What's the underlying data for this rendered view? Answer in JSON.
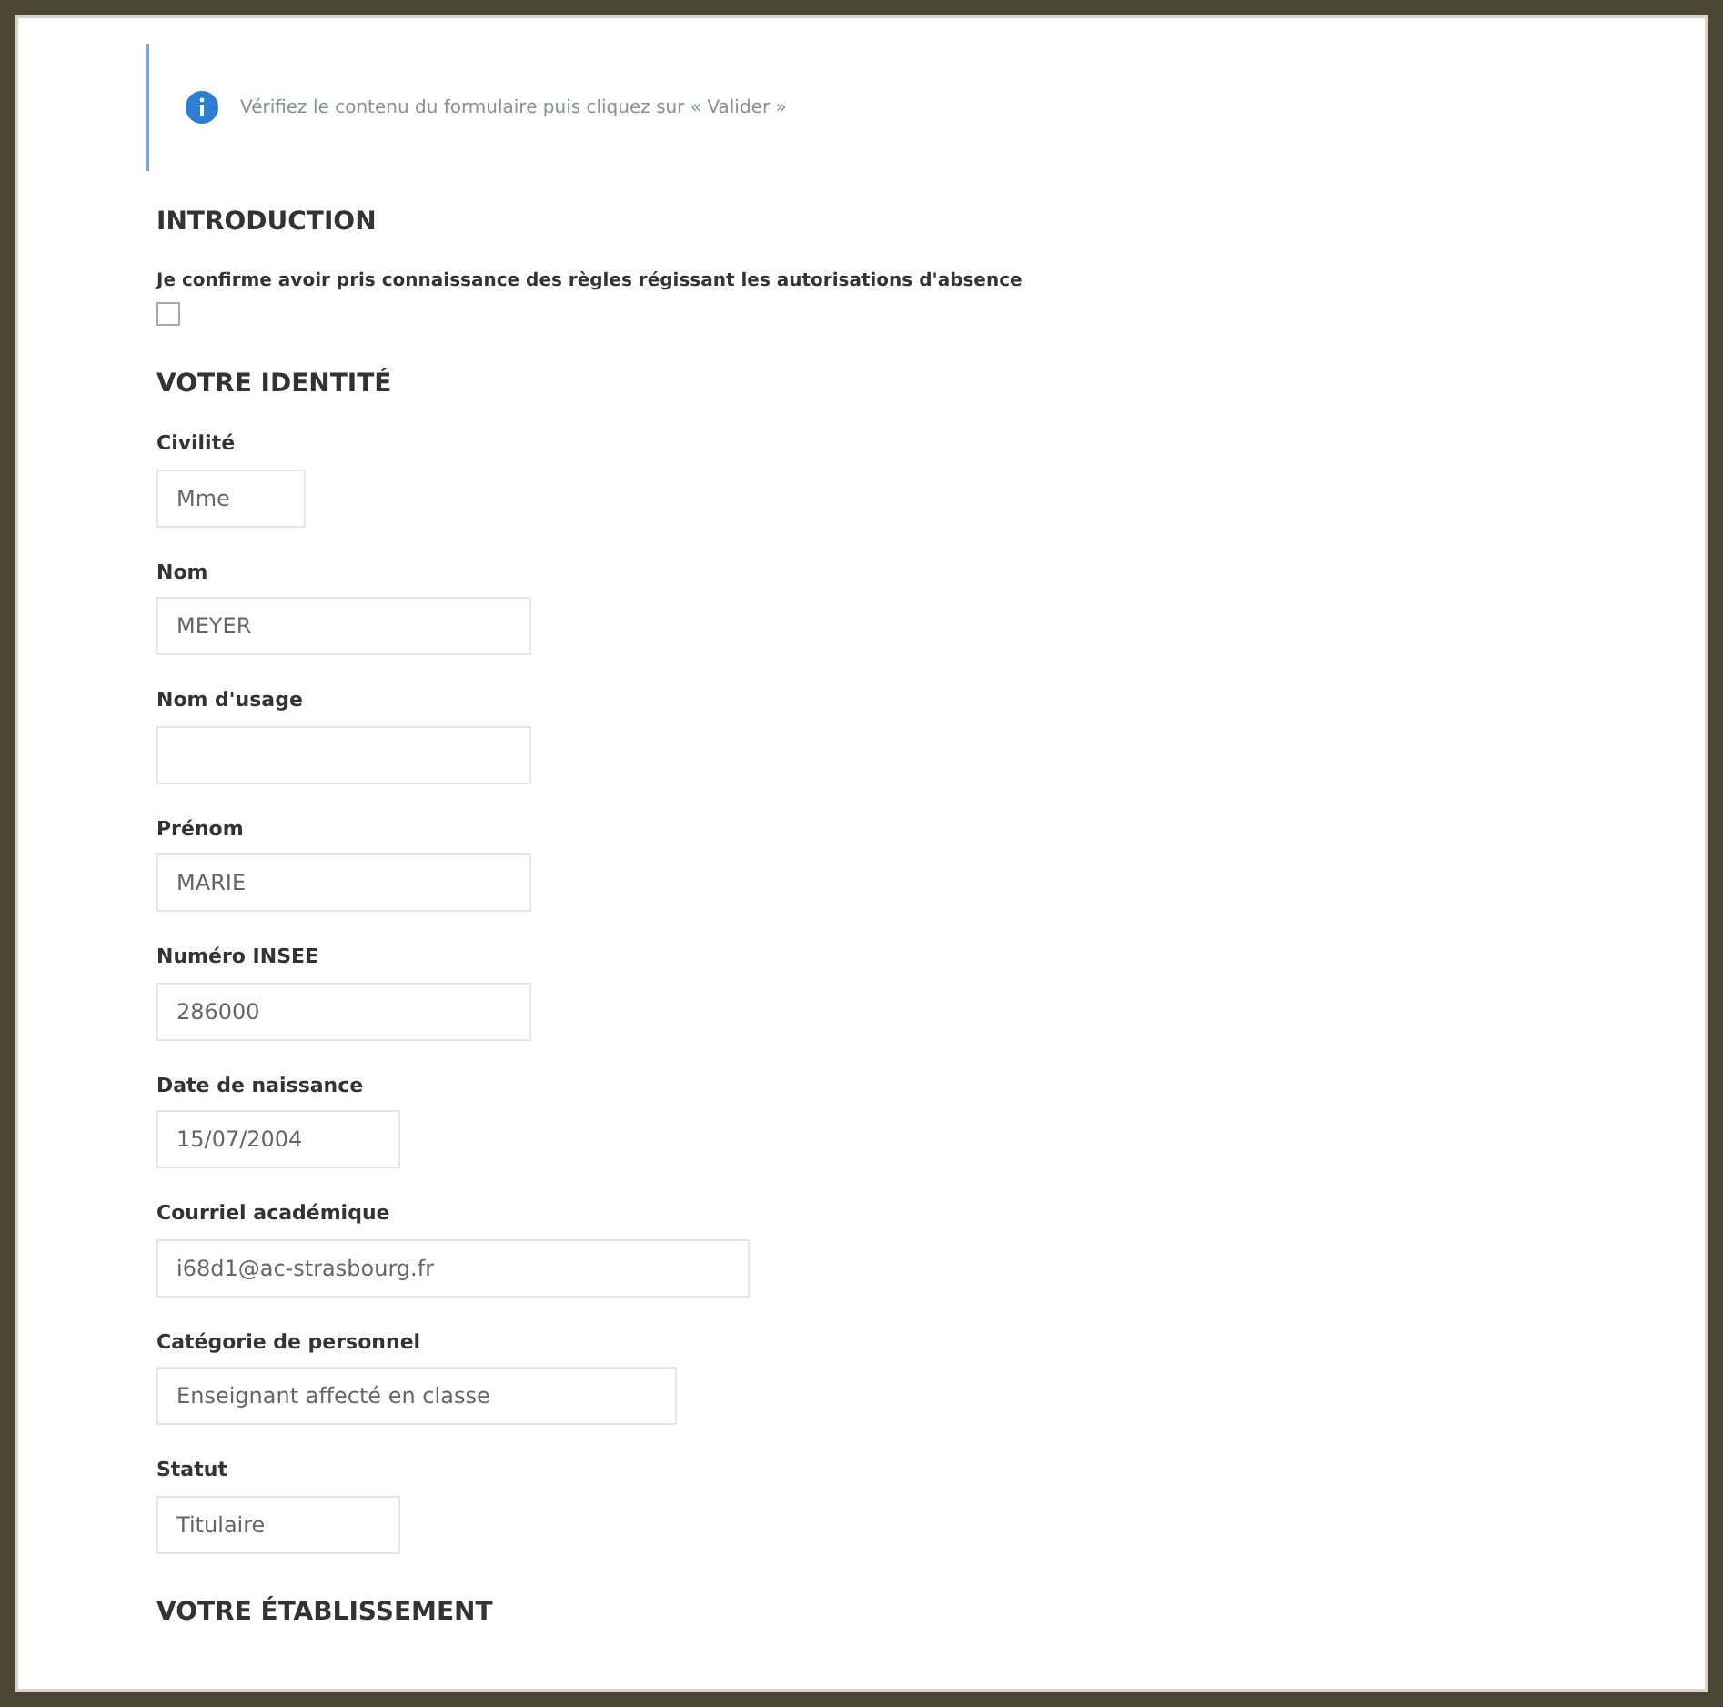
{
  "notice": {
    "text": "Vérifiez le contenu du formulaire puis cliquez sur « Valider »"
  },
  "sections": [
    {
      "title": "INTRODUCTION",
      "kind": "consent",
      "statement": "Je confirme avoir pris connaissance des règles régissant les autorisations d'absence",
      "checked": false
    },
    {
      "title": "VOTRE IDENTITÉ",
      "kind": "fields",
      "fields": [
        {
          "label": "Civilité",
          "value": "Mme"
        },
        {
          "label": "Nom",
          "value": "MEYER"
        },
        {
          "label": "Nom d'usage"
        },
        {
          "label": "Prénom",
          "value": "MARIE"
        },
        {
          "label": "Numéro INSEE",
          "value": "286000"
        },
        {
          "label": "Date de naissance",
          "value": "15/07/2004"
        },
        {
          "label": "Courriel académique",
          "value": "i68d1@ac-strasbourg.fr"
        },
        {
          "label": "Catégorie de personnel",
          "value": "Enseignant affecté en classe"
        },
        {
          "label": "Statut",
          "value": "Titulaire"
        }
      ]
    },
    {
      "title": "VOTRE ÉTABLISSEMENT",
      "kind": "fields"
    }
  ]
}
